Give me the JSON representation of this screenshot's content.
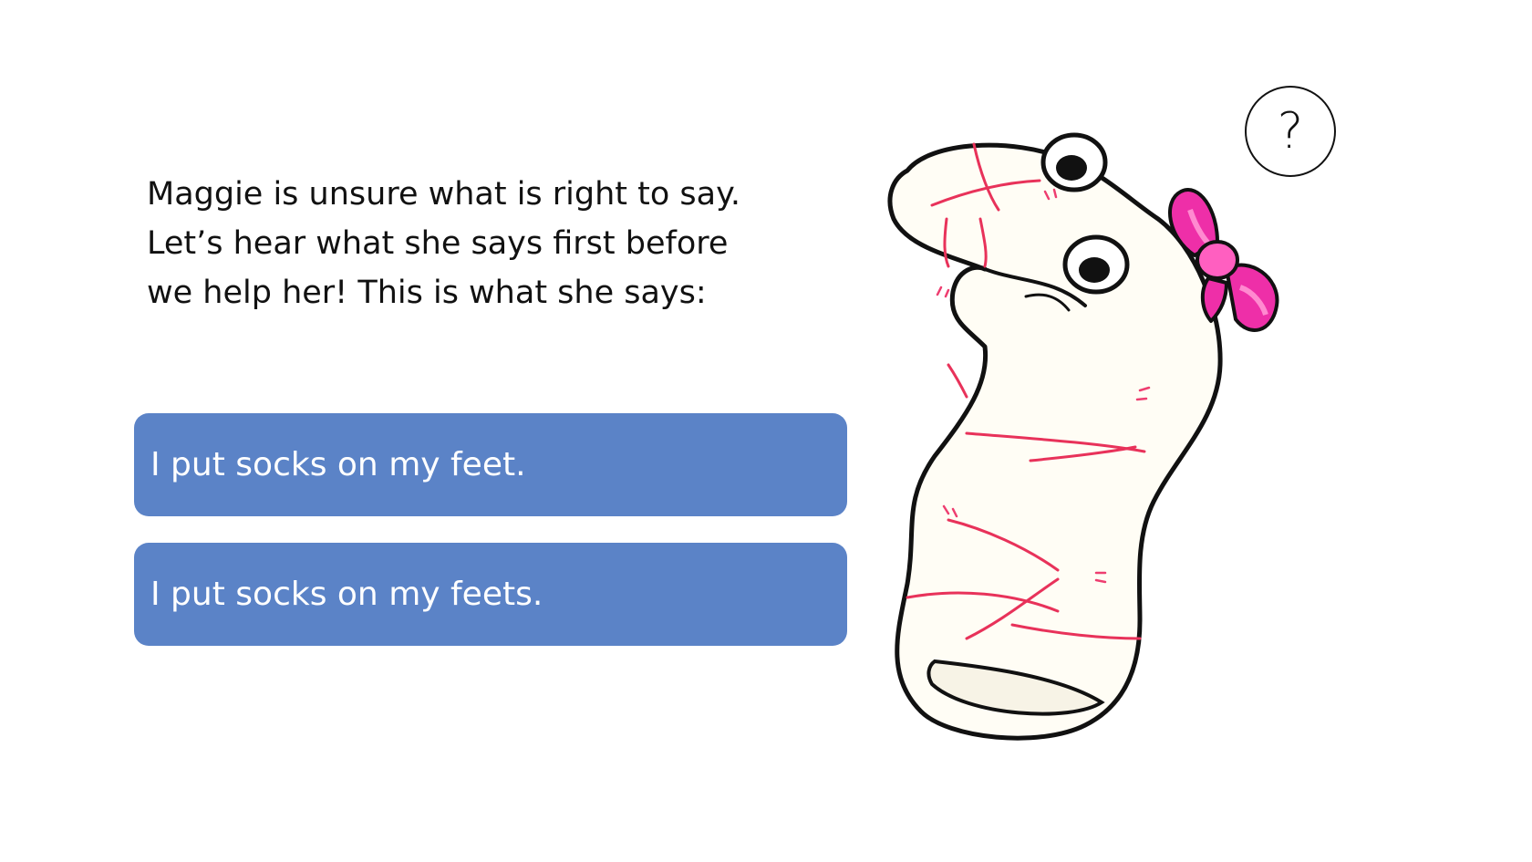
{
  "prompt": {
    "text": "Maggie is unsure what is right to say.\nLet’s hear what she says first before\nwe help her!  This is what she says:"
  },
  "choices": [
    {
      "label": "I put socks on my feet."
    },
    {
      "label": "I put socks on my feets."
    }
  ],
  "icons": {
    "question": "?"
  },
  "colors": {
    "choice_bg": "#5b83c7",
    "choice_text": "#ffffff",
    "bow": "#ee2fa8",
    "bow_light": "#ff8ad0",
    "stripe": "#e8325a",
    "sock": "#fffdf5"
  }
}
